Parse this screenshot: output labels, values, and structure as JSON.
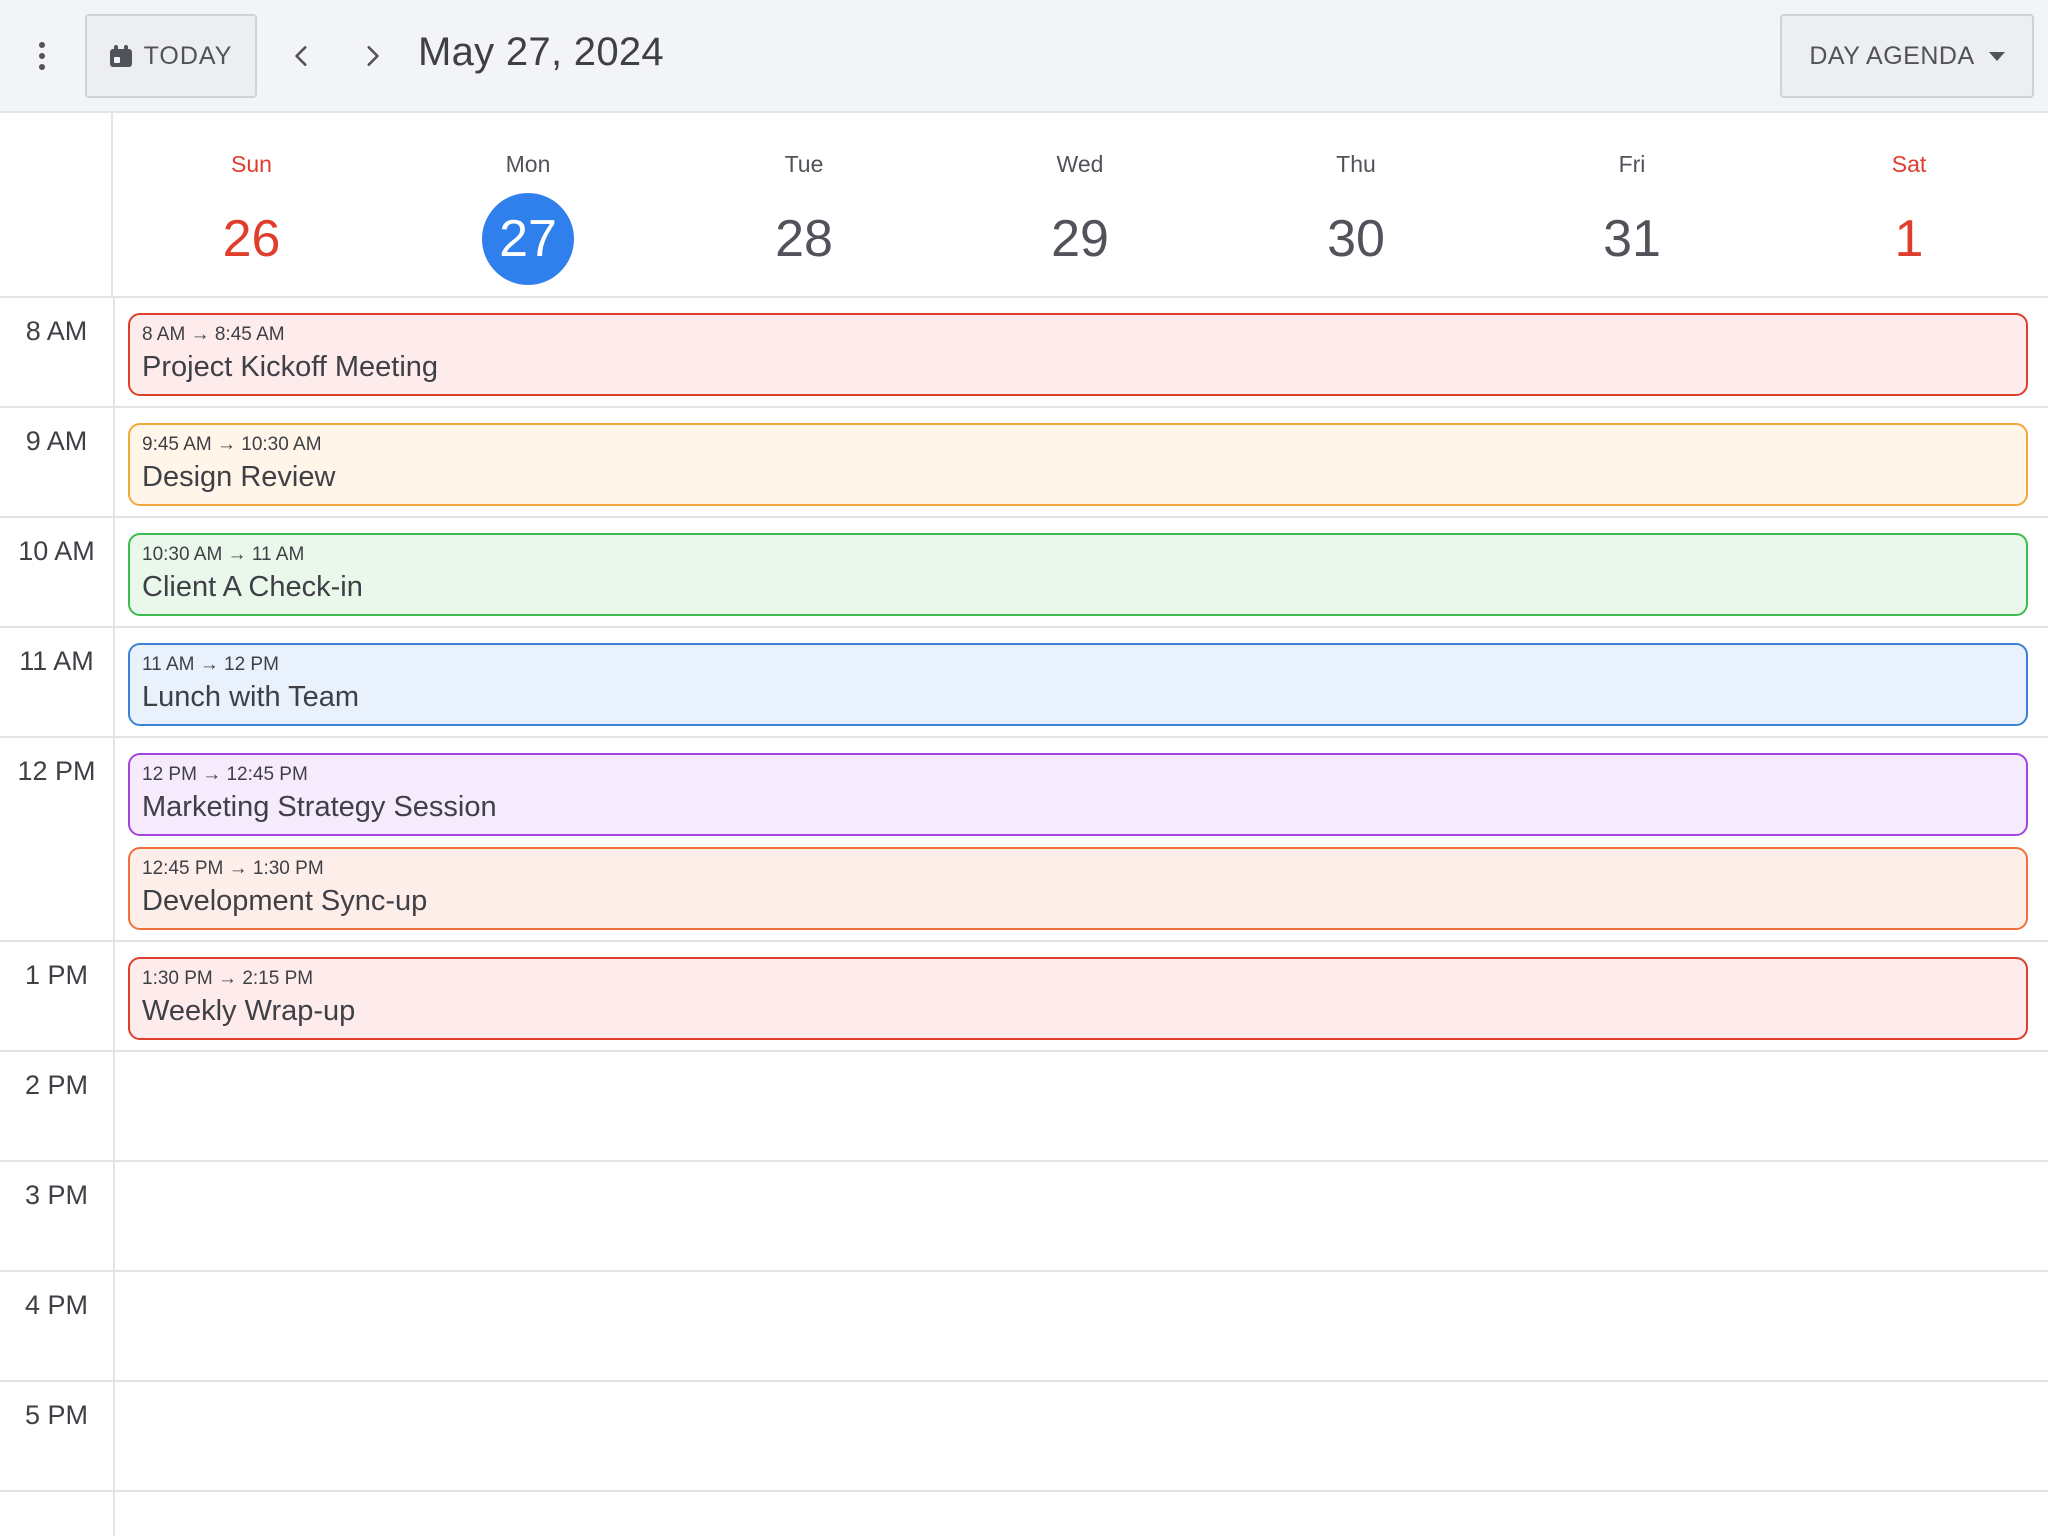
{
  "toolbar": {
    "today_label": "TODAY",
    "date_title": "May 27, 2024",
    "view_label": "DAY AGENDA"
  },
  "week": {
    "days": [
      {
        "name": "Sun",
        "num": "26"
      },
      {
        "name": "Mon",
        "num": "27"
      },
      {
        "name": "Tue",
        "num": "28"
      },
      {
        "name": "Wed",
        "num": "29"
      },
      {
        "name": "Thu",
        "num": "30"
      },
      {
        "name": "Fri",
        "num": "31"
      },
      {
        "name": "Sat",
        "num": "1"
      }
    ],
    "selected_index": 1
  },
  "agenda": {
    "hours": [
      "8 AM",
      "9 AM",
      "10 AM",
      "11 AM",
      "12 PM",
      "1 PM",
      "2 PM",
      "3 PM",
      "4 PM",
      "5 PM"
    ],
    "events": [
      {
        "time": "8 AM → 8:45 AM",
        "title": "Project Kickoff Meeting",
        "border": "#e03e2d",
        "bg": "#fdeceb"
      },
      {
        "time": "9:45 AM → 10:30 AM",
        "title": "Design Review",
        "border": "#f0a93a",
        "bg": "#fff5e8"
      },
      {
        "time": "10:30 AM → 11 AM",
        "title": "Client A Check-in",
        "border": "#3dbb4e",
        "bg": "#e9f8ea"
      },
      {
        "time": "11 AM → 12 PM",
        "title": "Lunch with Team",
        "border": "#3b82d6",
        "bg": "#e9f1fc"
      },
      {
        "time": "12 PM → 12:45 PM",
        "title": "Marketing Strategy Session",
        "border": "#a346e0",
        "bg": "#f6ebfd"
      },
      {
        "time": "12:45 PM → 1:30 PM",
        "title": "Development Sync-up",
        "border": "#f0703a",
        "bg": "#fdeee9"
      },
      {
        "time": "1:30 PM → 2:15 PM",
        "title": "Weekly Wrap-up",
        "border": "#e03e2d",
        "bg": "#fdeceb"
      }
    ]
  }
}
